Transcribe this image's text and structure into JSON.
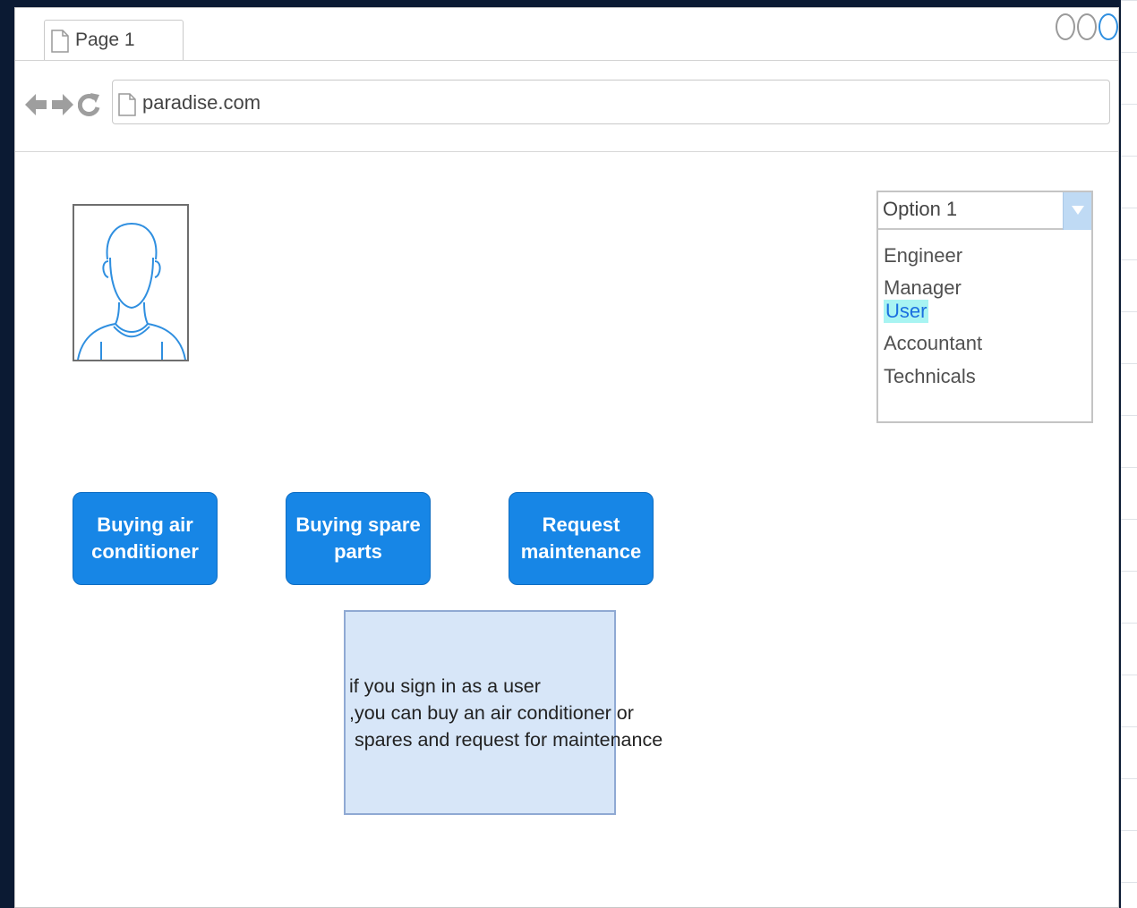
{
  "browser": {
    "tab_label": "Page 1",
    "url": "paradise.com",
    "icons": [
      "back-arrow-icon",
      "forward-arrow-icon",
      "refresh-icon",
      "document-icon"
    ]
  },
  "profile": {
    "icon": "user-avatar-icon"
  },
  "role_select": {
    "selected": "Option 1",
    "options": [
      "Engineer",
      "Manager",
      "User",
      "Accountant",
      "Technicals"
    ],
    "highlighted_option": "User"
  },
  "actions": [
    {
      "label": "Buying air\nconditioner"
    },
    {
      "label": "Buying spare\nparts"
    },
    {
      "label": "Request\nmaintenance"
    }
  ],
  "note": {
    "text": "if you sign in as a user\n,you can buy an air conditioner or\n spares and request for maintenance"
  },
  "colors": {
    "button": "#1786e6",
    "note_fill": "#d7e6f8",
    "highlight": "#a8f4f2",
    "outer_background": "#0b1a33"
  }
}
